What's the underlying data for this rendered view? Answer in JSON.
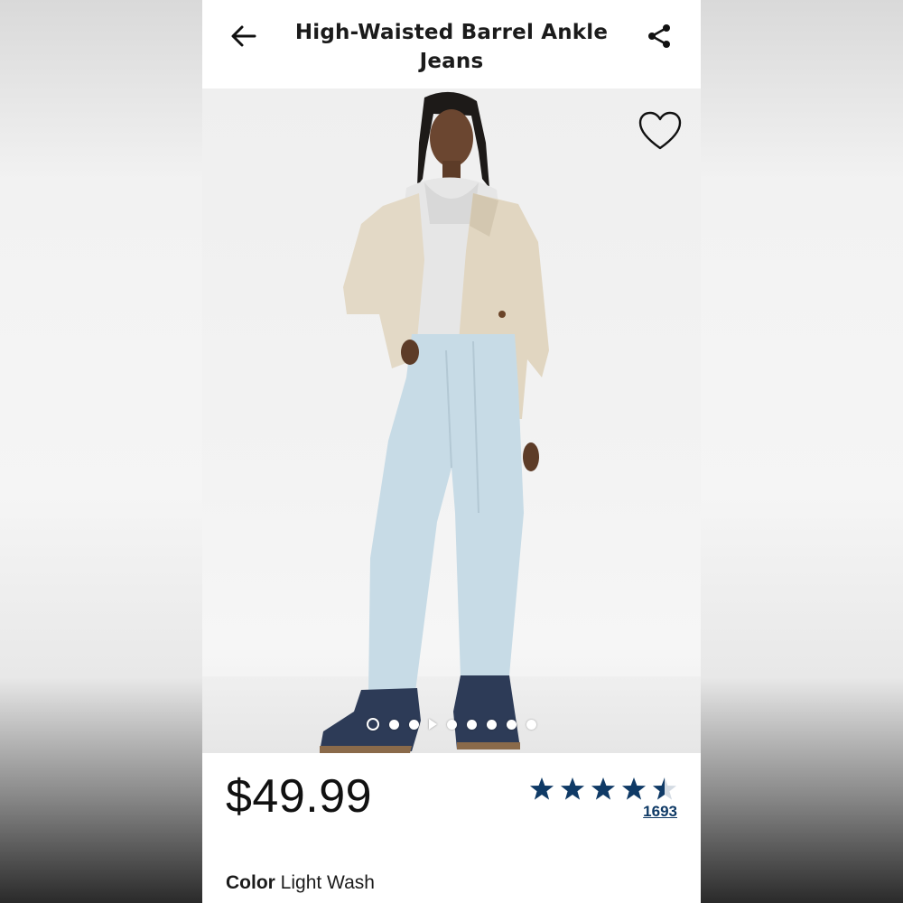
{
  "header": {
    "title": "High-Waisted Barrel Ankle Jeans",
    "back_icon": "arrow-left-icon",
    "share_icon": "share-icon"
  },
  "gallery": {
    "favorite_icon": "heart-outline-icon",
    "image_count": 9,
    "active_index": 0,
    "video_index": 3
  },
  "product": {
    "price": "$49.99",
    "rating": 4.5,
    "rating_max": 5,
    "review_count": "1693",
    "star_color": "#0f3a66",
    "color_label": "Color",
    "color_value": "Light Wash"
  }
}
